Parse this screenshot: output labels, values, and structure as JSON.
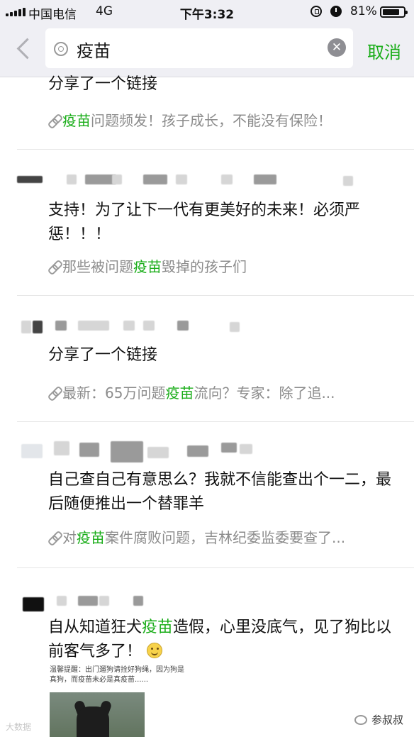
{
  "status_bar": {
    "carrier": "中国电信",
    "network": "4G",
    "time": "下午3:32",
    "battery": "81%",
    "battery_level": 0.81
  },
  "search": {
    "query": "疫苗",
    "cancel_label": "取消"
  },
  "posts": [
    {
      "text": "分享了一个链接",
      "link": {
        "prefix": "",
        "keyword": "疫苗",
        "suffix": "问题频发！孩子成长，不能没有保险！"
      }
    },
    {
      "text": "支持！为了让下一代有更美好的未来！必须严惩！！！",
      "link": {
        "prefix": "那些被问题",
        "keyword": "疫苗",
        "suffix": "毁掉的孩子们"
      }
    },
    {
      "text": "分享了一个链接",
      "link": {
        "prefix": "最新：65万问题",
        "keyword": "疫苗",
        "suffix": "流向？专家：除了追..."
      }
    },
    {
      "text": "自己查自己有意思么？我就不信能查出个一二，最后随便推出一个替罪羊",
      "link": {
        "prefix": "对",
        "keyword": "疫苗",
        "suffix": "案件腐败问题，吉林纪委监委要查了..."
      }
    },
    {
      "text_prefix": "自从知道狂犬",
      "keyword": "疫苗",
      "text_suffix": "造假，心里没底气，见了狗比以前客气多了！",
      "notice": "温馨提醒：出门遛狗请拴好狗绳，因为狗是真狗，而疫苗未必是真疫苗......"
    }
  ],
  "watermark": {
    "left": "大数据",
    "right": "参叔叔"
  }
}
